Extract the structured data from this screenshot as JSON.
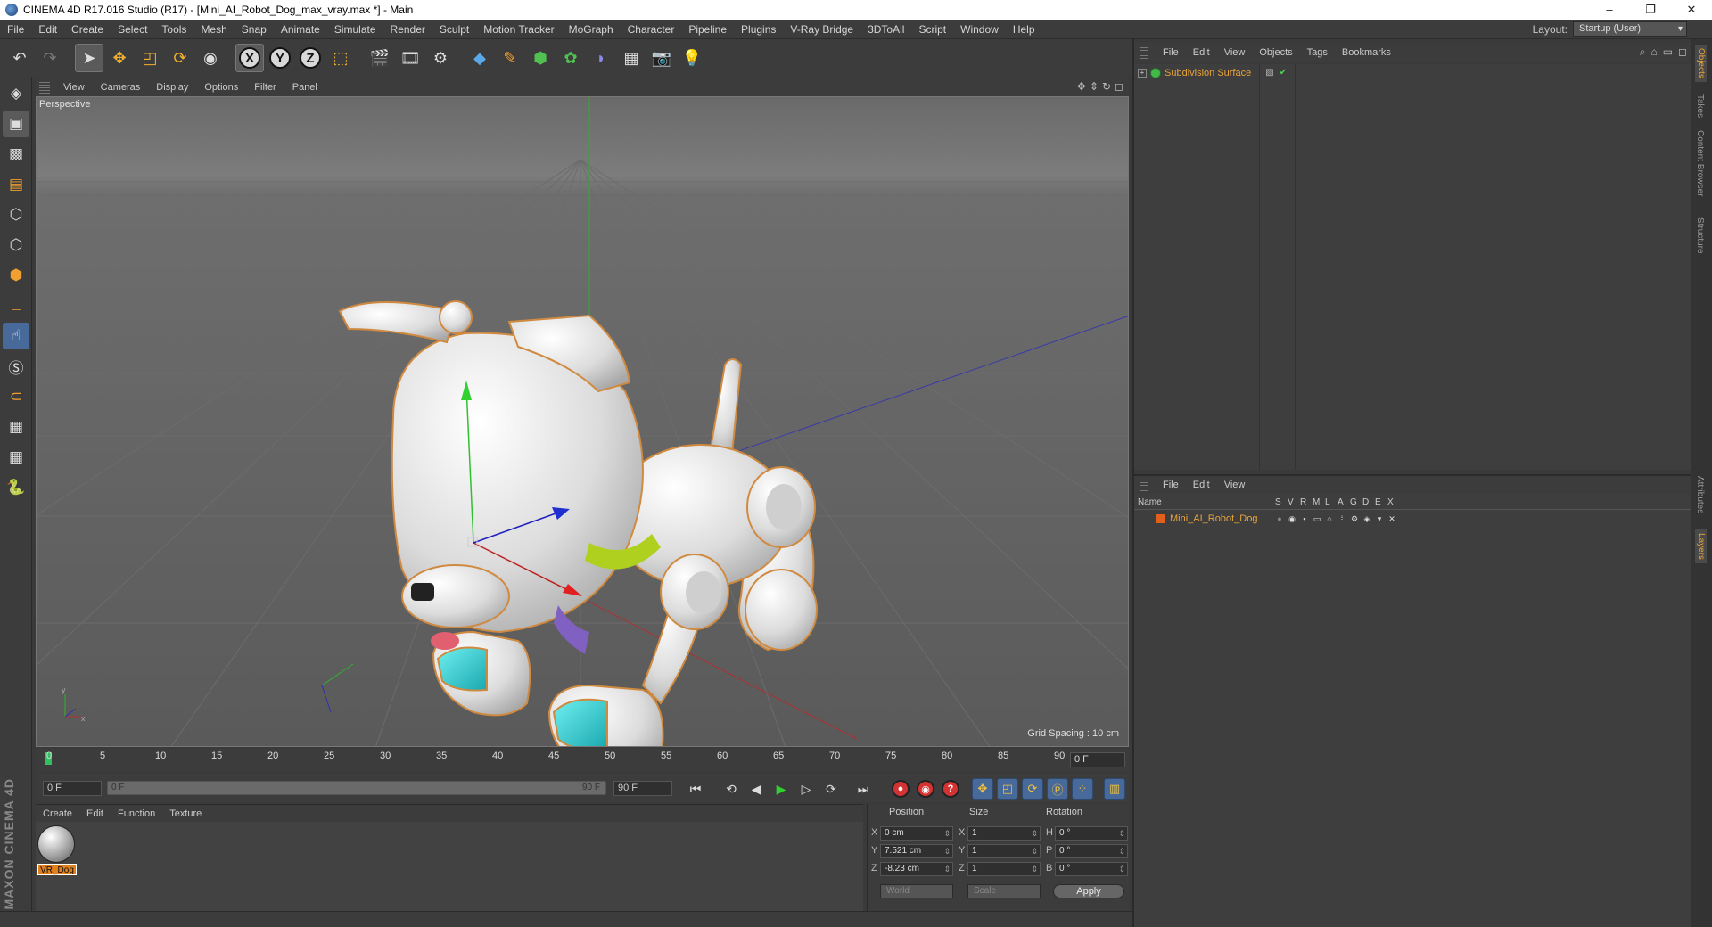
{
  "window": {
    "title": "CINEMA 4D R17.016 Studio (R17) - [Mini_AI_Robot_Dog_max_vray.max *] - Main",
    "controls": [
      "–",
      "❐",
      "✕"
    ]
  },
  "menubar": {
    "items": [
      "File",
      "Edit",
      "Create",
      "Select",
      "Tools",
      "Mesh",
      "Snap",
      "Animate",
      "Simulate",
      "Render",
      "Sculpt",
      "Motion Tracker",
      "MoGraph",
      "Character",
      "Pipeline",
      "Plugins",
      "V-Ray Bridge",
      "3DToAll",
      "Script",
      "Window",
      "Help"
    ],
    "layout_label": "Layout:",
    "layout_value": "Startup (User)"
  },
  "toolbar": {
    "axis_x": "X",
    "axis_y": "Y",
    "axis_z": "Z"
  },
  "viewport": {
    "menu": [
      "View",
      "Cameras",
      "Display",
      "Options",
      "Filter",
      "Panel"
    ],
    "camera_label": "Perspective",
    "grid_spacing": "Grid Spacing : 10 cm"
  },
  "timeline": {
    "ticks": [
      "0",
      "5",
      "10",
      "15",
      "20",
      "25",
      "30",
      "35",
      "40",
      "45",
      "50",
      "55",
      "60",
      "65",
      "70",
      "75",
      "80",
      "85",
      "90"
    ],
    "current_frame": "0 F",
    "start_field": "0 F",
    "range_start": "0 F",
    "range_end": "90 F",
    "end_field": "90 F"
  },
  "material_manager": {
    "menu": [
      "Create",
      "Edit",
      "Function",
      "Texture"
    ],
    "materials": [
      {
        "name": "VR_Dog"
      }
    ]
  },
  "coordinates": {
    "headers": {
      "position": "Position",
      "size": "Size",
      "rotation": "Rotation"
    },
    "axes_pos": [
      "X",
      "Y",
      "Z"
    ],
    "axes_rot": [
      "H",
      "P",
      "B"
    ],
    "position": [
      "0 cm",
      "7.521 cm",
      "-8.23 cm"
    ],
    "size": [
      "1",
      "1",
      "1"
    ],
    "rotation": [
      "0 °",
      "0 °",
      "0 °"
    ],
    "space_dropdown": "World",
    "mode_dropdown": "Scale",
    "apply_label": "Apply"
  },
  "object_manager": {
    "menu": [
      "File",
      "Edit",
      "View",
      "Objects",
      "Tags",
      "Bookmarks"
    ],
    "objects": [
      {
        "name": "Subdivision Surface"
      }
    ]
  },
  "layer_manager": {
    "menu": [
      "File",
      "Edit",
      "View"
    ],
    "column_name": "Name",
    "flags": [
      "S",
      "V",
      "R",
      "M",
      "L",
      "A",
      "G",
      "D",
      "E",
      "X"
    ],
    "layers": [
      {
        "name": "Mini_AI_Robot_Dog",
        "color": "#e0601c"
      }
    ]
  },
  "side_tabs": [
    "Objects",
    "Takes",
    "Content Browser",
    "Structure",
    "Attributes",
    "Layers"
  ],
  "branding": "MAXON CINEMA 4D",
  "colors": {
    "accent_orange": "#e8a33c",
    "viewport_bg": "#5b5b5b",
    "panel_bg": "#3c3c3c"
  }
}
